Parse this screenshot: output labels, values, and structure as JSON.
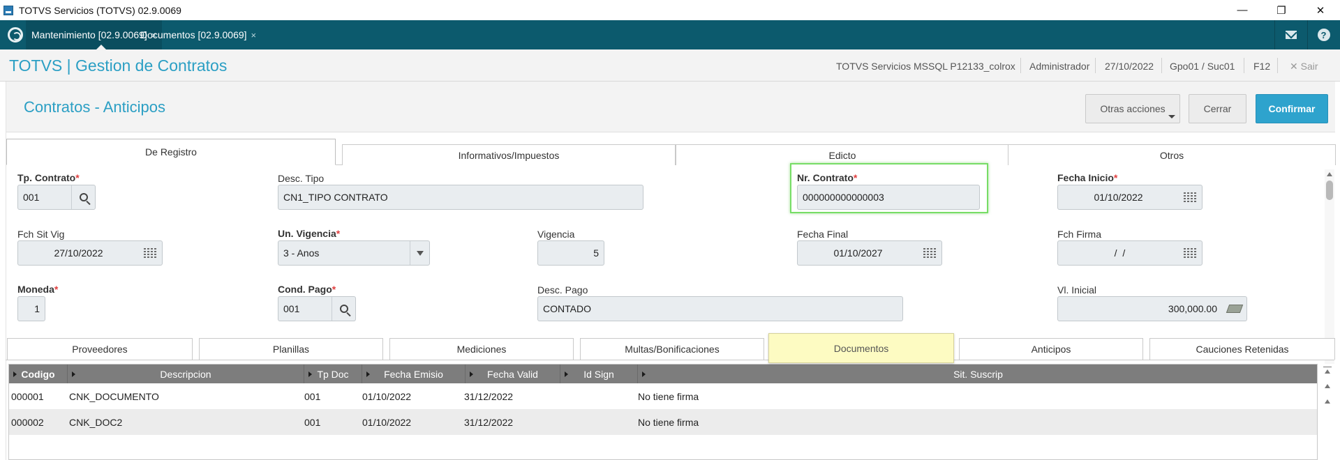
{
  "window": {
    "title": "TOTVS Servicios (TOTVS) 02.9.0069",
    "minimize": "—",
    "maximize": "❐",
    "close": "✕"
  },
  "tabs": [
    {
      "label": "Mantenimiento [02.9.0069]",
      "close": "×"
    },
    {
      "label": "Documentos [02.9.0069]",
      "close": "×"
    }
  ],
  "tabbar_icons": {
    "mail": "mail-icon",
    "help": "?"
  },
  "header": {
    "app_title": "TOTVS | Gestion de Contratos",
    "environment": "TOTVS Servicios MSSQL P12133_colrox",
    "user": "Administrador",
    "date": "27/10/2022",
    "branch": "Gpo01 / Suc01",
    "shortcut": "F12",
    "exit_icon": "✕",
    "exit": "Sair"
  },
  "page": {
    "title": "Contratos - Anticipos",
    "buttons": {
      "other_actions": "Otras acciones",
      "close": "Cerrar",
      "confirm": "Confirmar"
    }
  },
  "folders": [
    "De Registro",
    "Informativos/Impuestos",
    "Edicto",
    "Otros"
  ],
  "form": {
    "tp_contrato": {
      "label": "Tp. Contrato",
      "value": "001"
    },
    "desc_tipo": {
      "label": "Desc. Tipo",
      "value": "CN1_TIPO CONTRATO"
    },
    "nr_contrato": {
      "label": "Nr. Contrato",
      "value": "000000000000003"
    },
    "fecha_inicio": {
      "label": "Fecha Inicio",
      "value": "01/10/2022"
    },
    "fch_sit_vig": {
      "label": "Fch Sit Vig",
      "value": "27/10/2022"
    },
    "un_vigencia": {
      "label": "Un. Vigencia",
      "value": "3 - Anos"
    },
    "vigencia": {
      "label": "Vigencia",
      "value": "5"
    },
    "fecha_final": {
      "label": "Fecha Final",
      "value": "01/10/2027"
    },
    "fch_firma": {
      "label": "Fch Firma",
      "value": " /  /"
    },
    "moneda": {
      "label": "Moneda",
      "value": "1"
    },
    "cond_pago": {
      "label": "Cond. Pago",
      "value": "001"
    },
    "desc_pago": {
      "label": "Desc. Pago",
      "value": "CONTADO"
    },
    "vl_inicial": {
      "label": "Vl. Inicial",
      "value": "300,000.00"
    },
    "required_mark": "*"
  },
  "bottom_tabs": [
    "Proveedores",
    "Planillas",
    "Mediciones",
    "Multas/Bonificaciones",
    "Documentos",
    "Anticipos",
    "Cauciones Retenidas"
  ],
  "grid": {
    "columns": [
      "Codigo",
      "Descripcion",
      "Tp Doc",
      "Fecha Emisio",
      "Fecha Valid",
      "Id Sign",
      "Sit. Suscrip"
    ],
    "rows": [
      [
        "000001",
        "CNK_DOCUMENTO",
        "001",
        "01/10/2022",
        "31/12/2022",
        "",
        "No tiene firma"
      ],
      [
        "000002",
        "CNK_DOC2",
        "001",
        "01/10/2022",
        "31/12/2022",
        "",
        "No tiene firma"
      ]
    ]
  },
  "colors": {
    "tabbar": "#0c5a6d",
    "accent": "#2b9fc4",
    "primary_button": "#2ea3cd",
    "highlight_tab": "#fdfbc2",
    "focus": "#77dd66",
    "required": "#e04040"
  }
}
